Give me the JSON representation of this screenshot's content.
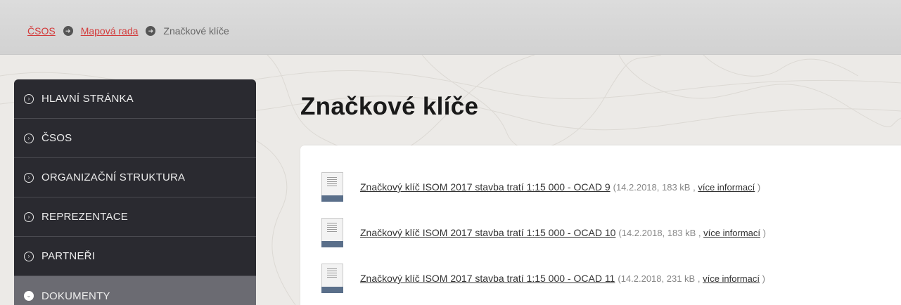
{
  "breadcrumb": {
    "items": [
      {
        "label": "ČSOS",
        "link": true
      },
      {
        "label": "Mapová rada",
        "link": true
      },
      {
        "label": "Značkové klíče",
        "link": false
      }
    ]
  },
  "sidebar": {
    "items": [
      {
        "label": "HLAVNÍ STRÁNKA"
      },
      {
        "label": "ČSOS"
      },
      {
        "label": "ORGANIZAČNÍ STRUKTURA"
      },
      {
        "label": "REPREZENTACE"
      },
      {
        "label": "PARTNEŘI"
      },
      {
        "label": "DOKUMENTY",
        "active": true
      }
    ]
  },
  "main": {
    "title": "Značkové klíče",
    "documents": [
      {
        "name": "Značkový klíč ISOM 2017 stavba tratí 1:15 000 - OCAD 9",
        "meta_prefix": "(14.2.2018, 183 kB ,",
        "more": "více informací",
        "meta_suffix": ")"
      },
      {
        "name": "Značkový klíč ISOM 2017 stavba tratí 1:15 000 - OCAD 10",
        "meta_prefix": "(14.2.2018, 183 kB ,",
        "more": "více informací",
        "meta_suffix": ")"
      },
      {
        "name": "Značkový klíč ISOM 2017 stavba tratí 1:15 000 - OCAD 11",
        "meta_prefix": "(14.2.2018, 231 kB ,",
        "more": "více informací",
        "meta_suffix": ")"
      }
    ]
  },
  "colors": {
    "link_red": "#d33b3b",
    "sidebar_bg": "#2a2a30",
    "sidebar_active": "#6b6b72",
    "doc_icon_band": "#5a6f8a"
  },
  "icons": {
    "breadcrumb_separator": "circle-arrow-icon",
    "sidebar_item": "circle-chevron-right-icon",
    "sidebar_active": "circle-chevron-down-icon",
    "document": "document-file-icon"
  }
}
